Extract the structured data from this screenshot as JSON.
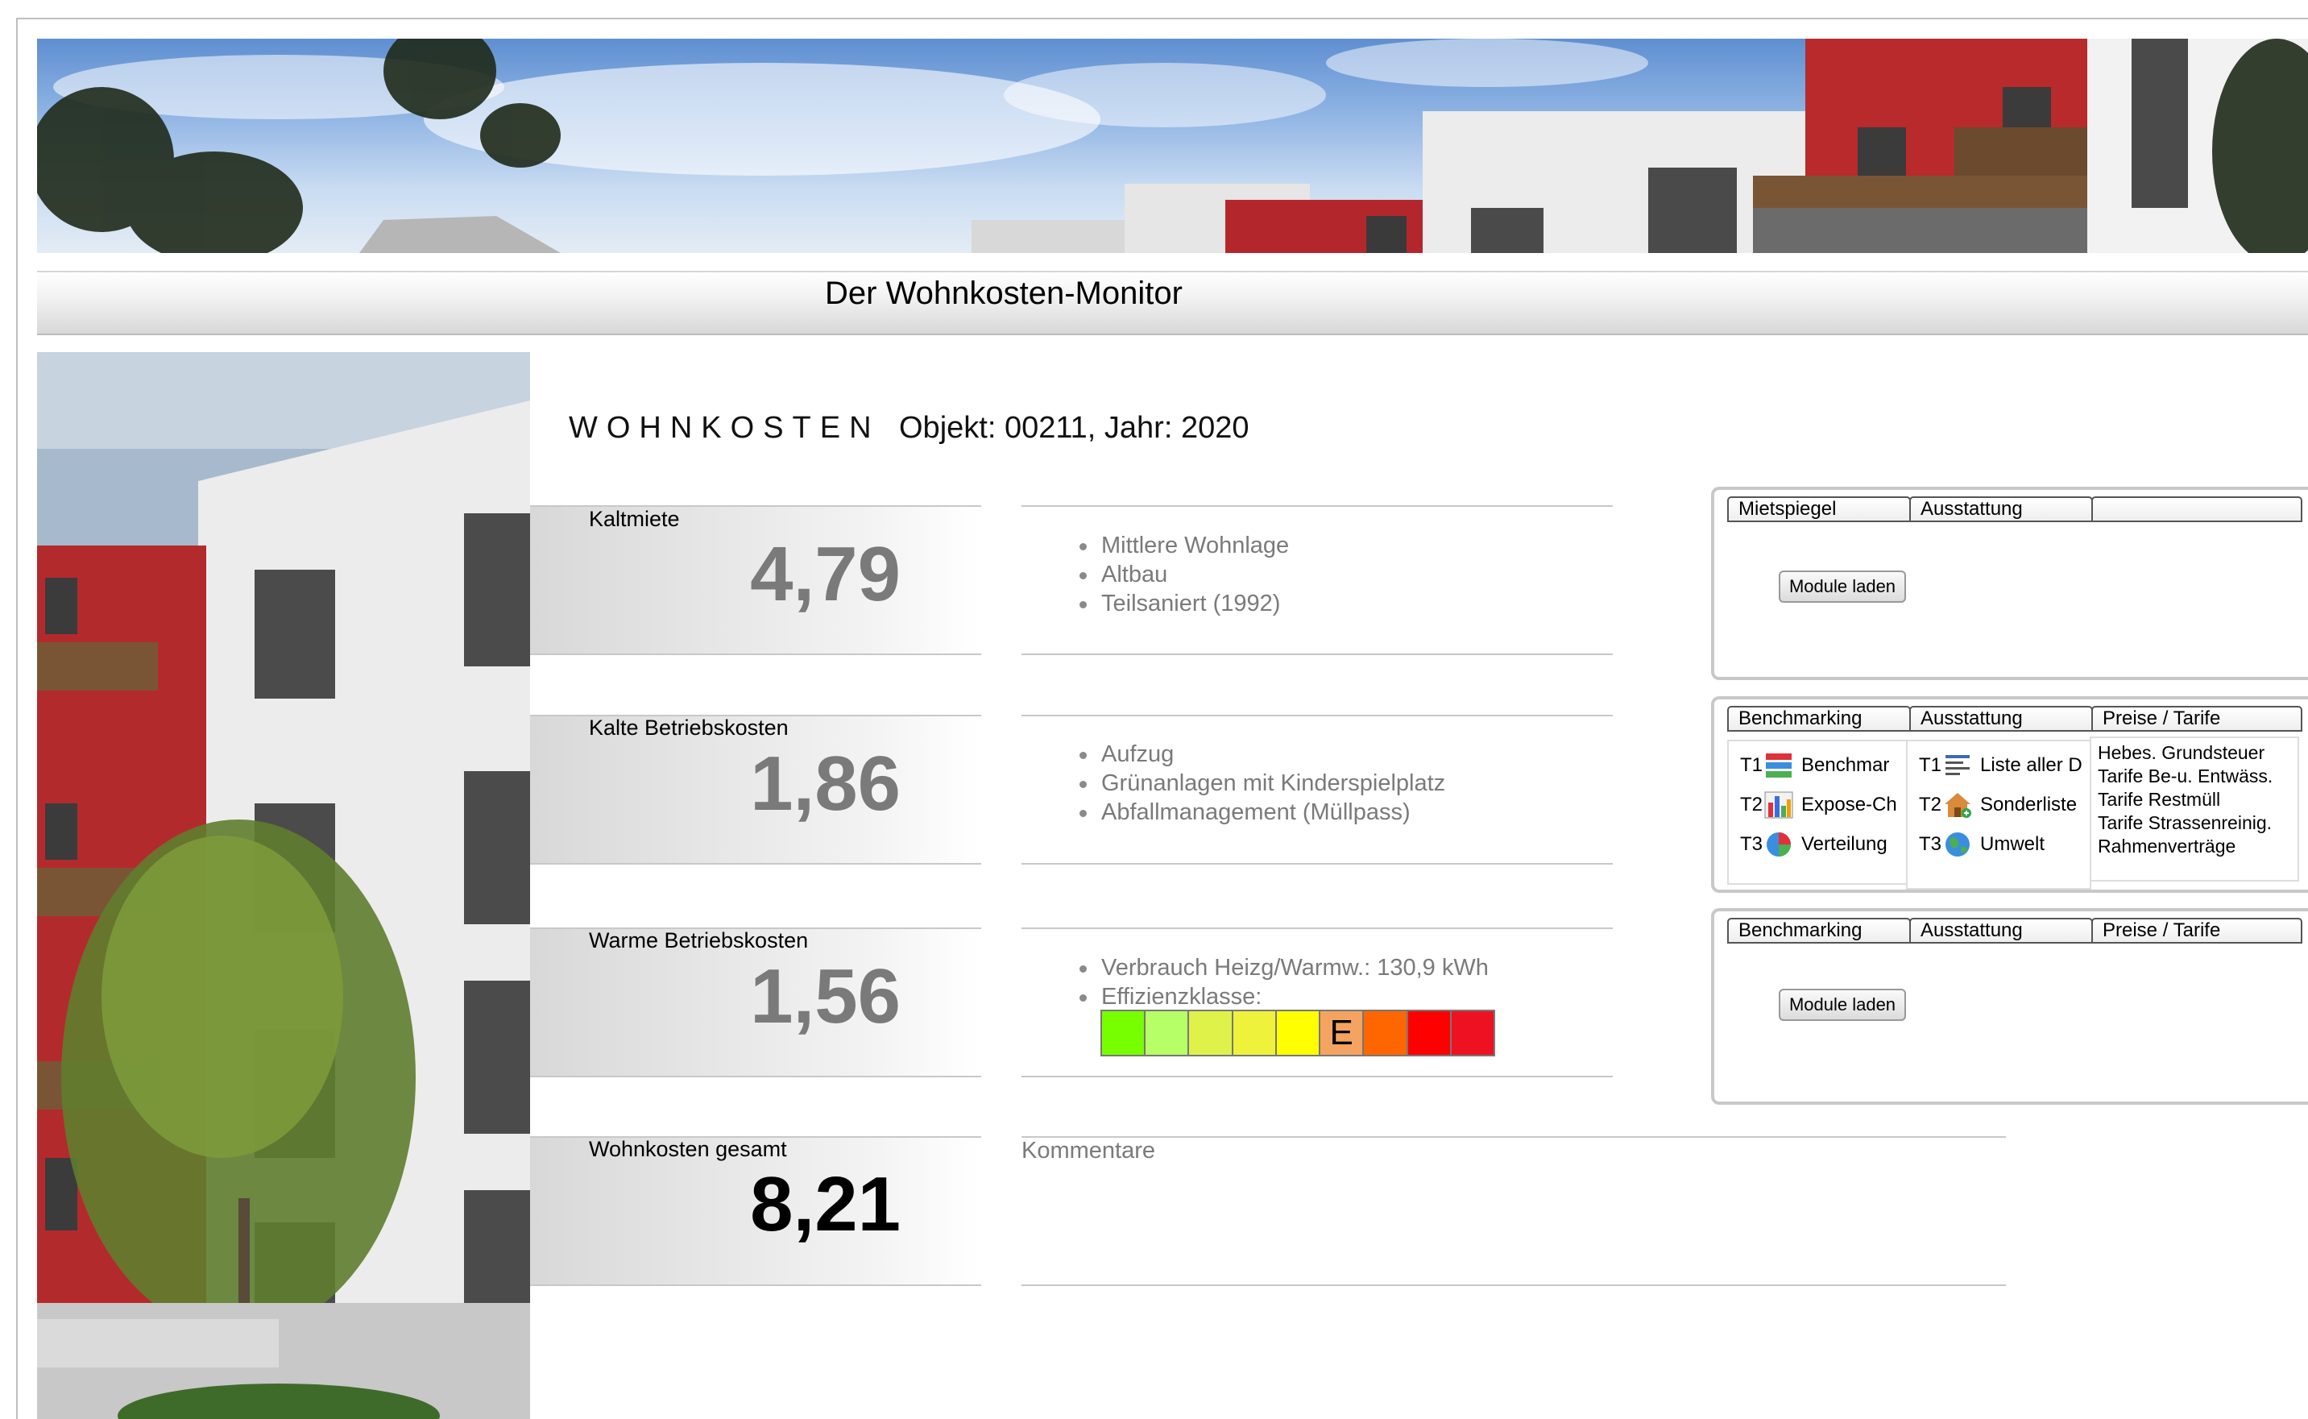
{
  "app": {
    "title": "Der Wohnkosten-Monitor"
  },
  "heading": {
    "section": "WOHNKOSTEN",
    "object_info": "Objekt: 00211, Jahr: 2020"
  },
  "metrics": [
    {
      "label": "Kaltmiete",
      "value": "4,79",
      "details": [
        "Mittlere Wohnlage",
        "Altbau",
        "Teilsaniert (1992)"
      ]
    },
    {
      "label": "Kalte Betriebskosten",
      "value": "1,86",
      "details": [
        "Aufzug",
        "Grünanlagen mit Kinderspielplatz",
        "Abfallmanagement (Müllpass)"
      ]
    },
    {
      "label": "Warme Betriebskosten",
      "value": "1,56",
      "details": [
        "Verbrauch Heizg/Warmw.: 130,9 kWh",
        "Effizienzklasse:"
      ]
    },
    {
      "label": "Wohnkosten gesamt",
      "value": "8,21"
    }
  ],
  "efficiency": {
    "selected": "E",
    "classes": [
      "",
      "",
      "",
      "",
      "",
      "E",
      "",
      "",
      ""
    ],
    "colors": [
      "#77ff00",
      "#b7ff66",
      "#dff24a",
      "#eff23a",
      "#ffff00",
      "#f4a460",
      "#ff6600",
      "#ff0000",
      "#ee1122"
    ]
  },
  "comments": {
    "label": "Kommentare"
  },
  "panels": {
    "p1": {
      "tabs": [
        "Mietspiegel",
        "Ausstattung",
        ""
      ],
      "button": "Module laden"
    },
    "p2": {
      "tabs": [
        "Benchmarking",
        "Ausstattung",
        "Preise / Tarife"
      ],
      "benchmarking": [
        {
          "t": "T1",
          "icon": "stacked-bars-icon",
          "label": "Benchmar"
        },
        {
          "t": "T2",
          "icon": "bar-chart-icon",
          "label": "Expose-Ch"
        },
        {
          "t": "T3",
          "icon": "pie-chart-icon",
          "label": "Verteilung"
        }
      ],
      "ausstattung": [
        {
          "t": "T1",
          "icon": "list-icon",
          "label": "Liste aller D"
        },
        {
          "t": "T2",
          "icon": "house-add-icon",
          "label": "Sonderliste"
        },
        {
          "t": "T3",
          "icon": "globe-icon",
          "label": "Umwelt"
        }
      ],
      "preise": [
        "Hebes. Grundsteuer",
        "Tarife Be-u. Entwäss.",
        "Tarife Restmüll",
        "Tarife Strassenreinig.",
        "Rahmenverträge"
      ]
    },
    "p3": {
      "tabs": [
        "Benchmarking",
        "Ausstattung",
        "Preise / Tarife"
      ],
      "button": "Module laden"
    }
  }
}
